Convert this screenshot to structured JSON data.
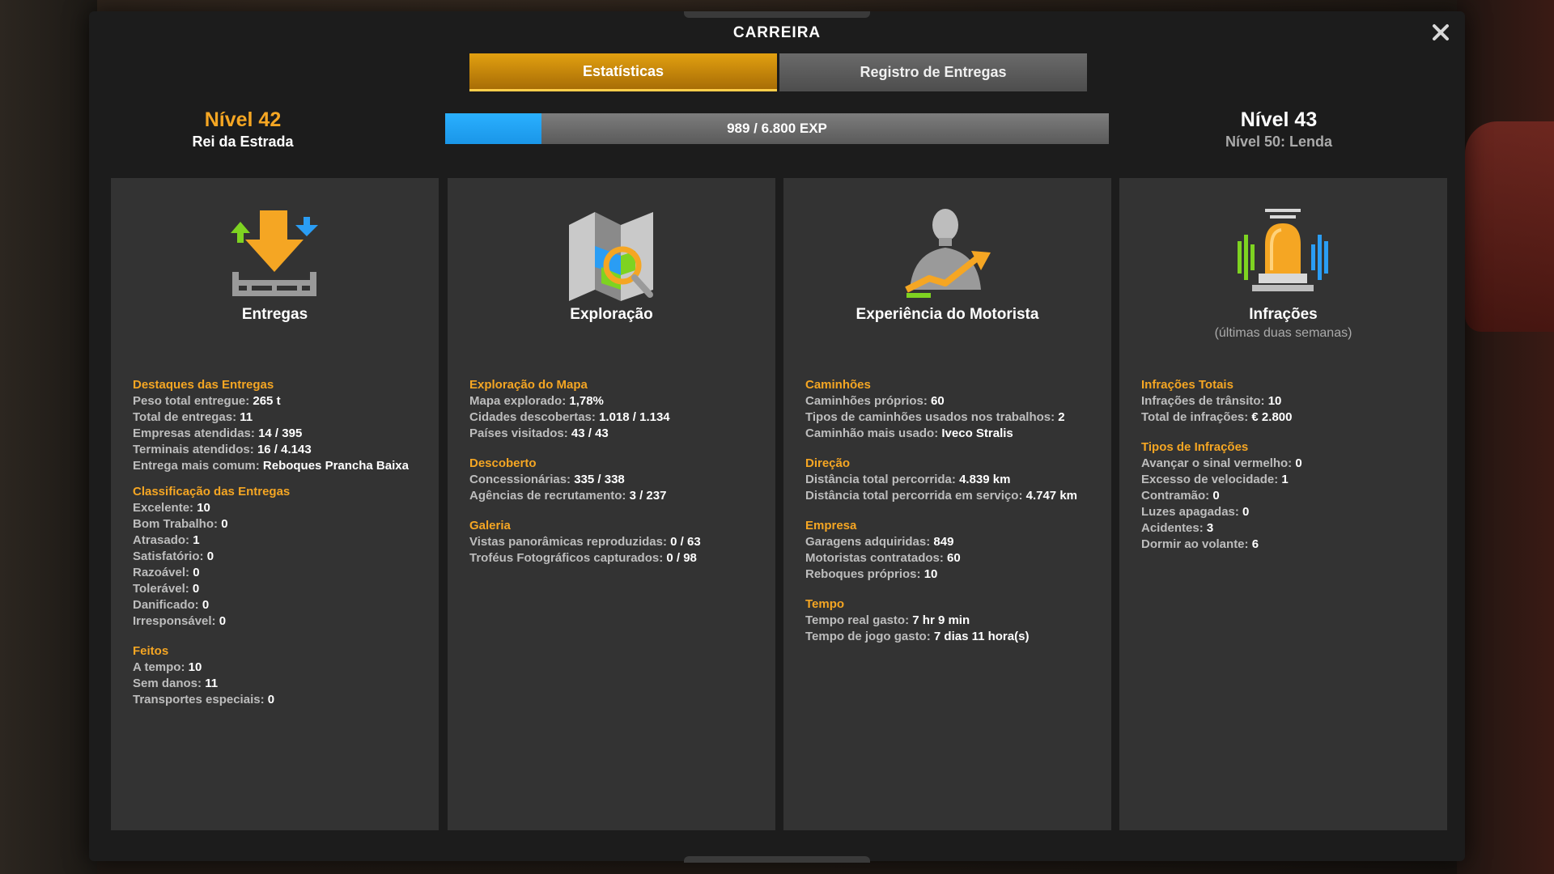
{
  "window": {
    "title": "CARREIRA"
  },
  "tabs": [
    {
      "label": "Estatísticas",
      "active": true
    },
    {
      "label": "Registro de Entregas",
      "active": false
    }
  ],
  "level": {
    "current": "Nível 42",
    "current_title": "Rei da Estrada",
    "next": "Nível 43",
    "next_subtitle": "Nível 50: Lenda",
    "xp_text": "989 / 6.800 EXP",
    "xp_current": 989,
    "xp_total": 6800
  },
  "colors": {
    "accent": "#f5a623",
    "xp_fill": "#1a96e8"
  },
  "panels": [
    {
      "icon": "delivery-icon",
      "title": "Entregas",
      "subtitle": "",
      "sections": [
        {
          "heading": "Destaques das Entregas",
          "items": [
            {
              "k": "Peso total entregue:",
              "v": "265 t"
            },
            {
              "k": "Total de entregas:",
              "v": "11"
            },
            {
              "k": "Empresas atendidas:",
              "v": "14 / 395"
            },
            {
              "k": "Terminais atendidos:",
              "v": "16 / 4.143"
            },
            {
              "k": "Entrega mais comum:",
              "v": "Reboques Prancha Baixa"
            }
          ]
        },
        {
          "heading": "Classificação das Entregas",
          "items": [
            {
              "k": "Excelente:",
              "v": "10"
            },
            {
              "k": "Bom Trabalho:",
              "v": "0"
            },
            {
              "k": "Atrasado:",
              "v": "1"
            },
            {
              "k": "Satisfatório:",
              "v": "0"
            },
            {
              "k": "Razoável:",
              "v": "0"
            },
            {
              "k": "Tolerável:",
              "v": "0"
            },
            {
              "k": "Danificado:",
              "v": "0"
            },
            {
              "k": "Irresponsável:",
              "v": "0"
            }
          ]
        },
        {
          "heading": "Feitos",
          "items": [
            {
              "k": "A tempo:",
              "v": "10"
            },
            {
              "k": "Sem danos:",
              "v": "11"
            },
            {
              "k": "Transportes especiais:",
              "v": "0"
            }
          ]
        }
      ]
    },
    {
      "icon": "map-explore-icon",
      "title": "Exploração",
      "subtitle": "",
      "sections": [
        {
          "heading": "Exploração do Mapa",
          "items": [
            {
              "k": "Mapa explorado:",
              "v": "1,78%"
            },
            {
              "k": "Cidades descobertas:",
              "v": "1.018 / 1.134"
            },
            {
              "k": "Países visitados:",
              "v": "43 / 43"
            }
          ]
        },
        {
          "heading": "Descoberto",
          "items": [
            {
              "k": "Concessionárias:",
              "v": "335 / 338"
            },
            {
              "k": "Agências de recrutamento:",
              "v": "3 / 237"
            }
          ]
        },
        {
          "heading": "Galeria",
          "items": [
            {
              "k": "Vistas panorâmicas reproduzidas:",
              "v": "0 / 63"
            },
            {
              "k": "Troféus Fotográficos capturados:",
              "v": "0 / 98"
            }
          ]
        }
      ]
    },
    {
      "icon": "driver-experience-icon",
      "title": "Experiência do Motorista",
      "subtitle": "",
      "sections": [
        {
          "heading": "Caminhões",
          "items": [
            {
              "k": "Caminhões próprios:",
              "v": "60"
            },
            {
              "k": "Tipos de caminhões usados nos trabalhos:",
              "v": "2"
            },
            {
              "k": "Caminhão mais usado:",
              "v": "Iveco Stralis"
            }
          ]
        },
        {
          "heading": "Direção",
          "items": [
            {
              "k": "Distância total percorrida:",
              "v": "4.839 km"
            },
            {
              "k": "Distância total percorrida em serviço:",
              "v": "4.747 km"
            }
          ]
        },
        {
          "heading": "Empresa",
          "items": [
            {
              "k": "Garagens adquiridas:",
              "v": "849"
            },
            {
              "k": "Motoristas contratados:",
              "v": "60"
            },
            {
              "k": "Reboques próprios:",
              "v": "10"
            }
          ]
        },
        {
          "heading": "Tempo",
          "items": [
            {
              "k": "Tempo real gasto:",
              "v": "7 hr 9 min"
            },
            {
              "k": "Tempo de jogo gasto:",
              "v": "7 dias 11 hora(s)"
            }
          ]
        }
      ]
    },
    {
      "icon": "siren-icon",
      "title": "Infrações",
      "subtitle": "(últimas duas semanas)",
      "sections": [
        {
          "heading": "Infrações Totais",
          "items": [
            {
              "k": "Infrações de trânsito:",
              "v": "10"
            },
            {
              "k": "Total de infrações:",
              "v": "€ 2.800"
            }
          ]
        },
        {
          "heading": "Tipos de Infrações",
          "items": [
            {
              "k": "Avançar o sinal vermelho:",
              "v": "0"
            },
            {
              "k": "Excesso de velocidade:",
              "v": "1"
            },
            {
              "k": "Contramão:",
              "v": "0"
            },
            {
              "k": "Luzes apagadas:",
              "v": "0"
            },
            {
              "k": "Acidentes:",
              "v": "3"
            },
            {
              "k": "Dormir ao volante:",
              "v": "6"
            }
          ]
        }
      ]
    }
  ]
}
